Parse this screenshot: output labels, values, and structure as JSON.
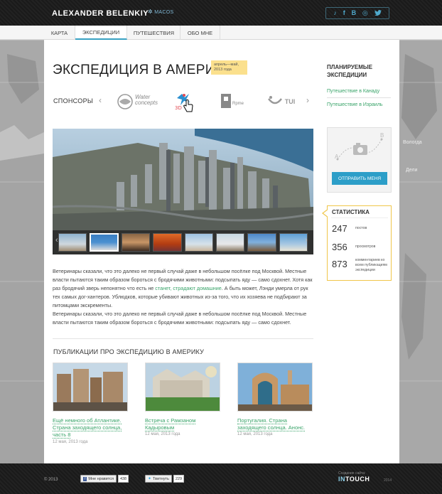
{
  "header": {
    "brand": "ALEXANDER BELENKIY",
    "sub_label": "MACOS",
    "social": [
      "♪",
      "f",
      "B",
      "◎",
      "🐦"
    ]
  },
  "nav": {
    "items": [
      {
        "label": "КАРТА"
      },
      {
        "label": "ЭКСПЕДИЦИИ"
      },
      {
        "label": "ПУТЕШЕСТВИЯ"
      },
      {
        "label": "ОБО МНЕ"
      }
    ]
  },
  "map": {
    "labels": [
      "Вологда",
      "Дели"
    ]
  },
  "main": {
    "title": "ЭКСПЕДИЦИЯ В АМЕРИКУ",
    "date_badge": "апрель—май, 2013 года",
    "sponsors_label": "СПОНСОРЫ",
    "sponsors": [
      "Water concepts",
      "3D",
      "Rpme",
      "TUI"
    ],
    "paragraph1_a": "Ветеринары сказали, что это далеко не первый случай даже в небольшом посёлке под Москвой. Местные власти пытаются таким образом бороться с бродячими животными: подсыпать яду — само сдохнет. Хотя как раз бродячий зверь непонятно что есть не ",
    "paragraph1_link": "станет, страдают домашние",
    "paragraph1_b": ". А быть может, Лэнди умерла от рук тех самых дог-хантеров. Ублюдков, которые убивают животных из-за того, что их хозяева не подбирают за питомцами экскременты.",
    "paragraph2": "Ветеринары сказали, что это далеко не первый случай даже в небольшом посёлке под Москвой. Местные власти пытаются таким образом бороться с бродячими животными: подсыпать яду — само сдохнет.",
    "publications_title": "ПУБЛИКАЦИИ ПРО ЭКСПЕДИЦИЮ В АМЕРИКУ",
    "publications": [
      {
        "title": "Ещё немного об Атлантике. Страна заходящего солнца, часть 8",
        "date": "12 мая, 2013 года"
      },
      {
        "title": "Встреча с Рамзаном Кадыровым",
        "date": "12 мая, 2013 года"
      },
      {
        "title": "Португалия. Страна заходящего солнца. Анонс.",
        "date": "12 мая, 2013 года"
      }
    ]
  },
  "sidebar": {
    "planned_title": "ПЛАНИРУЕМЫЕ ЭКСПЕДИЦИИ",
    "planned_links": [
      "Путешествие в Канаду",
      "Путешествие в Израиль"
    ],
    "send_label_a": "A",
    "send_label_b": "B",
    "send_button": "ОТПРАВИТЬ МЕНЯ",
    "stats_title": "СТАТИСТИКА",
    "stats": [
      {
        "num": "247",
        "label": "постов"
      },
      {
        "num": "356",
        "label": "просмотров"
      },
      {
        "num": "873",
        "label": "комментариев ко всем публикациям экспедиции"
      }
    ]
  },
  "footer": {
    "copyright": "© 2013",
    "fb_like": "Мне нравится",
    "fb_count": "438",
    "tw_button": "Твитнуть",
    "tw_count": "229",
    "made_by": "Создание сайта:",
    "studio_a": "IN",
    "studio_b": "TOUCH",
    "studio_year": "2014"
  }
}
